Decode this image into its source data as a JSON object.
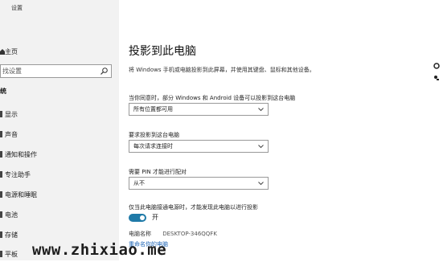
{
  "window": {
    "title": "设置"
  },
  "sidebar": {
    "home_label": "主页",
    "search_placeholder": "找设置",
    "section_label": "统",
    "items": [
      {
        "label": "显示"
      },
      {
        "label": "声音"
      },
      {
        "label": "通知和操作"
      },
      {
        "label": "专注助手"
      },
      {
        "label": "电源和睡眠"
      },
      {
        "label": "电池"
      },
      {
        "label": "存储"
      },
      {
        "label": "平板"
      }
    ]
  },
  "main": {
    "title": "投影到此电脑",
    "description": "将 Windows 手机或电脑投影到此屏幕，并使用其键盘、鼠标和其他设备。",
    "setting1": {
      "label": "当你同意时，部分 Windows 和 Android 设备可以投影到这台电脑",
      "value": "所有位置都可用"
    },
    "setting2": {
      "label": "要求投影到这台电脑",
      "value": "每次请求连接时"
    },
    "setting3": {
      "label": "需要 PIN 才能进行配对",
      "value": "从不"
    },
    "power": {
      "label": "仅当此电脑接通电源时，才能发现此电脑以进行投影",
      "toggle_text": "开"
    },
    "pc_name_label": "电脑名称",
    "pc_name": "DESKTOP-346QQFK",
    "rename_link": "重命名你的电脑"
  },
  "watermark": "www.zhixiao.me",
  "colors": {
    "accent": "#1f7aa8",
    "link": "#1b63b5",
    "sidebar_bg": "#f2f2f2"
  }
}
